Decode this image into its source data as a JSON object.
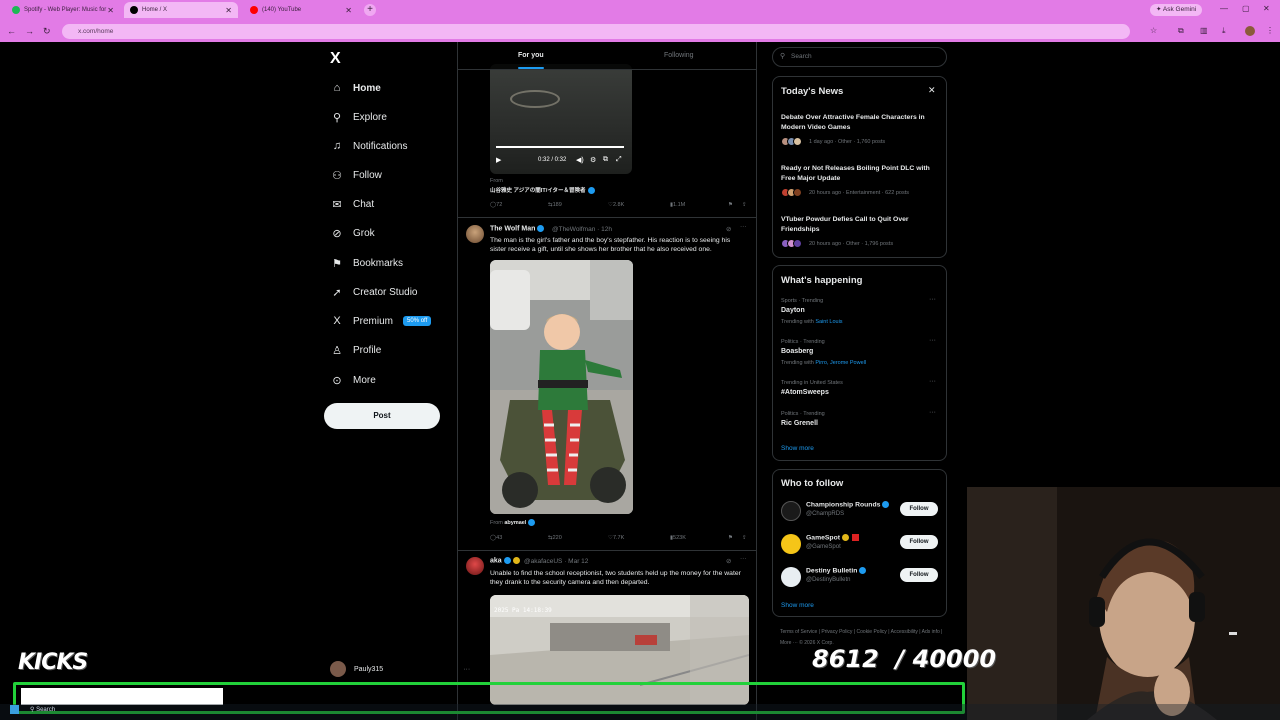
{
  "browser": {
    "tabs": [
      {
        "title": "Spotify - Web Player: Music for",
        "color": "#1db954"
      },
      {
        "title": "Home / X",
        "color": "#000000"
      },
      {
        "title": "(140) YouTube",
        "color": "#ff0000"
      }
    ],
    "ask_gemini": "Ask Gemini",
    "url": "x.com/home"
  },
  "sidebar": {
    "logo": "X",
    "items": [
      {
        "label": "Home",
        "icon": "home-icon",
        "glyph": "⌂"
      },
      {
        "label": "Explore",
        "icon": "search-icon",
        "glyph": "⚲"
      },
      {
        "label": "Notifications",
        "icon": "bell-icon",
        "glyph": "🔔"
      },
      {
        "label": "Follow",
        "icon": "follow-icon",
        "glyph": "⚇"
      },
      {
        "label": "Chat",
        "icon": "chat-icon",
        "glyph": "✉"
      },
      {
        "label": "Grok",
        "icon": "grok-icon",
        "glyph": "⊘"
      },
      {
        "label": "Bookmarks",
        "icon": "bookmark-icon",
        "glyph": "⚑"
      },
      {
        "label": "Creator Studio",
        "icon": "rocket-icon",
        "glyph": "➚"
      },
      {
        "label": "Premium",
        "icon": "x-premium-icon",
        "glyph": "X",
        "badge": "50% off"
      },
      {
        "label": "Profile",
        "icon": "profile-icon",
        "glyph": "⚲"
      },
      {
        "label": "More",
        "icon": "more-circle-icon",
        "glyph": "⊙"
      }
    ],
    "post_label": "Post",
    "account_name": "Pauly315"
  },
  "feed": {
    "tabs": [
      "For you",
      "Following"
    ],
    "tweet0": {
      "time_display": "0:32 / 0:32",
      "from_label": "From",
      "from_source": "山谷雅史 アジアの闇IT/イター＆冒険者",
      "stats": [
        "72",
        "189",
        "2.8K",
        "1.1M"
      ]
    },
    "tweet1": {
      "name": "The Wolf Man",
      "handle": "@TheWolfman · 12h",
      "text": "The man is the girl's father and the boy's stepfather. His reaction is to seeing his sister receive a gift, until she shows her brother that he also received one.",
      "from_label": "From",
      "from_source": "abymael",
      "stats": [
        "43",
        "220",
        "7.7K",
        "523K"
      ]
    },
    "tweet2": {
      "name": "aka",
      "handle": "@akafaceUS · Mar 12",
      "text": "Unable to find the school receptionist, two students held up the money for the water they drank to the security camera and then departed.",
      "cam_stamp": "2025 Pa  14:18:39"
    }
  },
  "right": {
    "search_placeholder": "Search",
    "news": {
      "title": "Today's News",
      "items": [
        {
          "headline": "Debate Over Attractive Female Characters in Modern Video Games",
          "meta": "1 day ago · Other · 1,760 posts"
        },
        {
          "headline": "Ready or Not Releases Boiling Point DLC with Free Major Update",
          "meta": "20 hours ago · Entertainment · 622 posts"
        },
        {
          "headline": "VTuber Powdur Defies Call to Quit Over Friendships",
          "meta": "20 hours ago · Other · 1,796 posts"
        }
      ]
    },
    "happening": {
      "title": "What's happening",
      "items": [
        {
          "meta": "Sports · Trending",
          "name": "Dayton",
          "with": "Trending with",
          "with_names": "Saint Louis"
        },
        {
          "meta": "Politics · Trending",
          "name": "Boasberg",
          "with": "Trending with",
          "with_names": "Pirro, Jerome Powell"
        },
        {
          "meta": "Trending in United States",
          "name": "#AtomSweeps",
          "with": "",
          "with_names": ""
        },
        {
          "meta": "Politics · Trending",
          "name": "Ric Grenell",
          "with": "",
          "with_names": ""
        }
      ],
      "show_more": "Show more"
    },
    "who_to_follow": {
      "title": "Who to follow",
      "items": [
        {
          "name": "Championship Rounds",
          "handle": "@ChampRDS",
          "avatar_color": "#1a1a1a"
        },
        {
          "name": "GameSpot",
          "handle": "@GameSpot",
          "avatar_color": "#f5c518"
        },
        {
          "name": "Destiny Bulletin",
          "handle": "@DestinyBulletn",
          "avatar_color": "#e8eef2"
        }
      ],
      "follow_label": "Follow",
      "show_more": "Show more"
    },
    "footer": [
      "Terms of Service",
      "Privacy Policy",
      "Cookie Policy",
      "Accessibility",
      "Ads info",
      "More ···",
      "© 2026 X Corp."
    ]
  },
  "overlay": {
    "kicks_label": "KICKS",
    "kicks_count": "8612  / 40000",
    "kicks_progress": 0.2153,
    "taskbar_search": "Search"
  }
}
